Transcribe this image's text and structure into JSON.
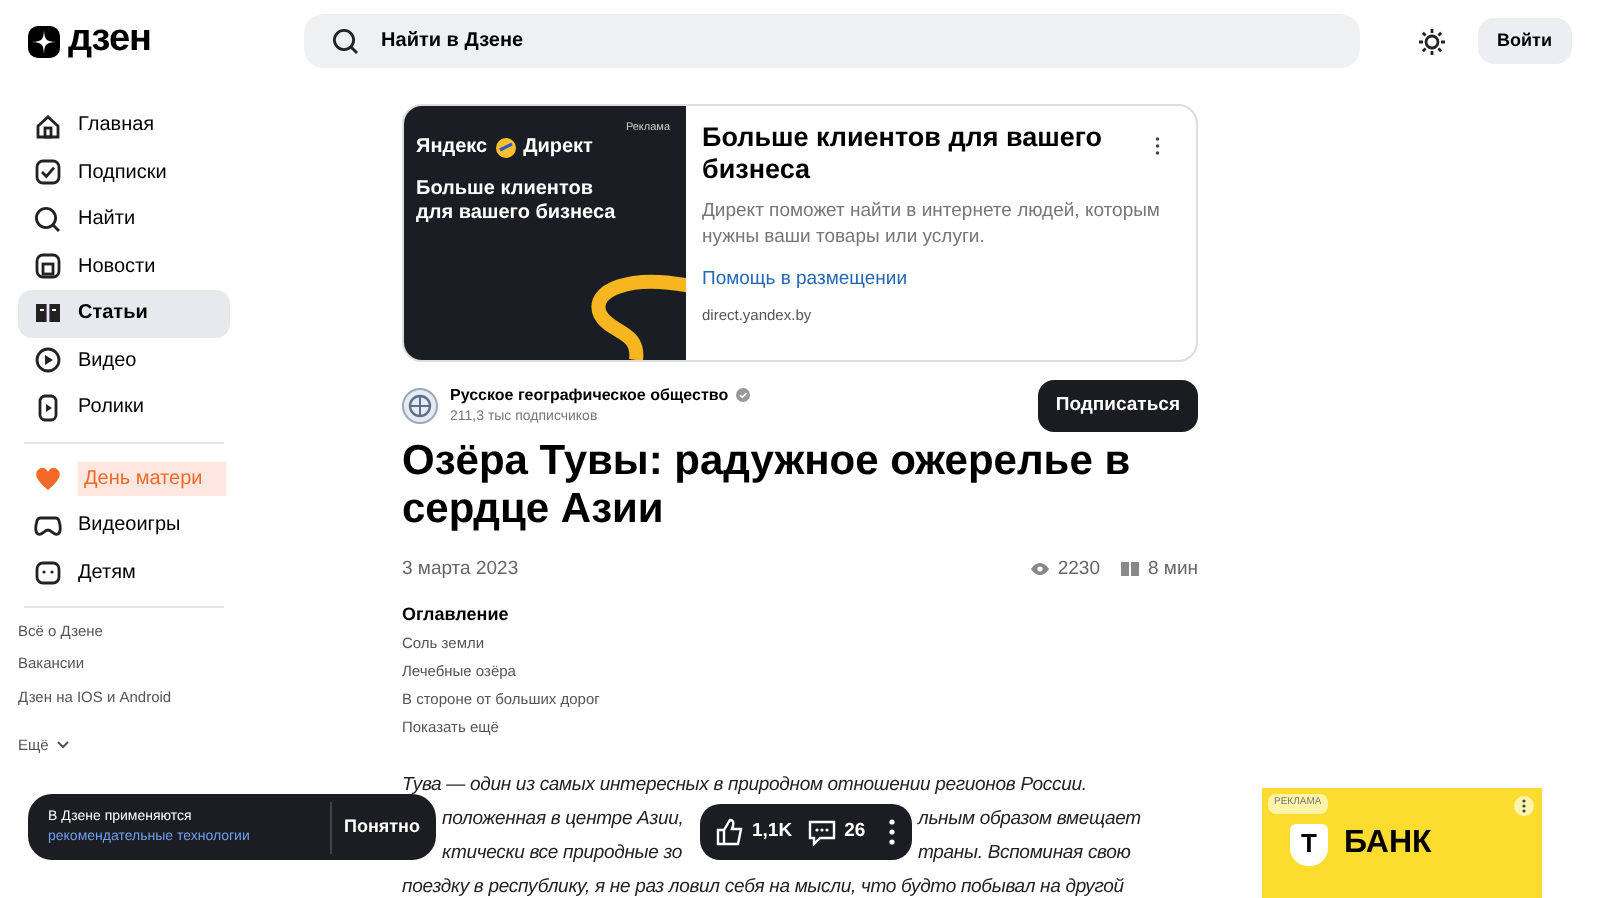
{
  "header": {
    "logo": "дзен",
    "search_placeholder": "Найти в Дзене",
    "login": "Войти"
  },
  "sidebar": {
    "items": [
      {
        "label": "Главная",
        "selected": false
      },
      {
        "label": "Подписки",
        "selected": false
      },
      {
        "label": "Найти",
        "selected": false
      },
      {
        "label": "Новости",
        "selected": false
      },
      {
        "label": "Статьи",
        "selected": true
      },
      {
        "label": "Видео",
        "selected": false
      },
      {
        "label": "Ролики",
        "selected": false
      }
    ],
    "special": [
      {
        "label": "День матери",
        "kind": "promo"
      },
      {
        "label": "Видеоигры",
        "kind": "normal"
      },
      {
        "label": "Детям",
        "kind": "normal"
      }
    ],
    "links": [
      "Всё о Дзене",
      "Вакансии",
      "Дзен на IOS и Android"
    ],
    "more": "Ещё"
  },
  "ad": {
    "label": "Реклама",
    "brand": "Яндекс",
    "brand2": "Директ",
    "image_text": "Больше клиентов для вашего бизнеса",
    "title": "Больше клиентов для вашего бизнеса",
    "text": "Директ поможет найти в интернете людей, которым нужны ваши товары или услуги.",
    "link": "Помощь в размещении",
    "domain": "direct.yandex.by"
  },
  "channel": {
    "name": "Русское географическое общество",
    "verified": true,
    "subscribers": "211,3 тыс подписчиков",
    "subscribe": "Подписаться"
  },
  "article": {
    "title": "Озёра Тувы: радужное ожерелье в сердце Азии",
    "date": "3 марта 2023",
    "views": "2230",
    "read_time": "8 мин",
    "toc": {
      "heading": "Оглавление",
      "items": [
        "Соль земли",
        "Лечебные озёра",
        "В стороне от больших дорог"
      ],
      "more": "Показать ещё"
    },
    "lines": [
      [
        "Тува — один из самых интересных в природном отношении регионов России."
      ],
      [
        "положенная в центре Азии,",
        "льным образом вмещает"
      ],
      [
        "ктически все природные зо",
        "траны. Вспоминая свою"
      ],
      [
        "поездку в республику, я не раз ловил себя на мысли, что будто побывал на другой"
      ]
    ]
  },
  "cookie": {
    "text": "В Дзене применяются",
    "link": "рекомендательные технологии",
    "button": "Понятно"
  },
  "actions": {
    "likes": "1,1K",
    "comments": "26"
  },
  "side_ad": {
    "label": "РЕКЛАМА",
    "logo_letter": "Т",
    "brand": "БАНК"
  }
}
